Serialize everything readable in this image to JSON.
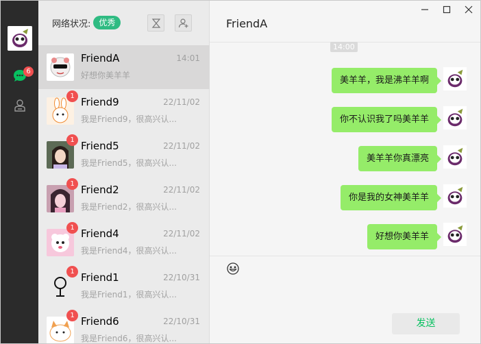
{
  "nav": {
    "unread_badge": "6"
  },
  "status": {
    "label": "网络状况:",
    "quality": "优秀"
  },
  "contacts": [
    {
      "name": "FriendA",
      "time": "14:01",
      "preview": "好想你美羊羊",
      "badge": ""
    },
    {
      "name": "Friend9",
      "time": "22/11/02",
      "preview": "我是Friend9，很高兴认...",
      "badge": "1"
    },
    {
      "name": "Friend5",
      "time": "22/11/02",
      "preview": "我是Friend5，很高兴认...",
      "badge": "1"
    },
    {
      "name": "Friend2",
      "time": "22/11/02",
      "preview": "我是Friend2，很高兴认...",
      "badge": "1"
    },
    {
      "name": "Friend4",
      "time": "22/11/02",
      "preview": "我是Friend4，很高兴认...",
      "badge": "1"
    },
    {
      "name": "Friend1",
      "time": "22/10/31",
      "preview": "我是Friend1，很高兴认...",
      "badge": "1"
    },
    {
      "name": "Friend6",
      "time": "22/10/31",
      "preview": "我是Friend6，很高兴认...",
      "badge": "1"
    }
  ],
  "chat": {
    "title": "FriendA",
    "timestamp": "14:00",
    "messages": [
      "美羊羊，我是沸羊羊啊",
      "你不认识我了吗美羊羊",
      "美羊羊你真漂亮",
      "你是我的女神美羊羊",
      "好想你美羊羊"
    ],
    "send_label": "发送"
  },
  "colors": {
    "accent": "#2fbb82",
    "bubble": "#95ec69",
    "badge": "#f05050",
    "nav_bg": "#2b2b2b"
  }
}
